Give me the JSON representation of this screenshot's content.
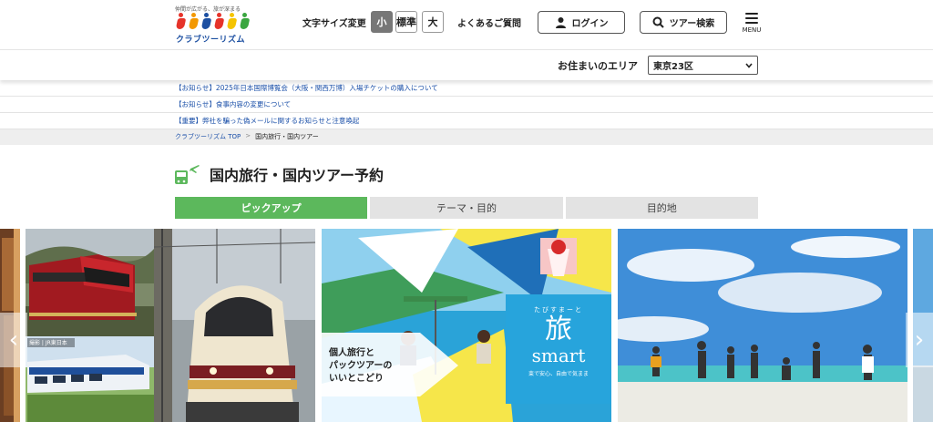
{
  "header": {
    "logo_tagline": "仲間が広がる、旅が深まる",
    "logo_name": "クラブツーリズム",
    "fontsize_label": "文字サイズ変更",
    "fontsize_small": "小",
    "fontsize_standard": "標準",
    "fontsize_large": "大",
    "faq": "よくあるご質問",
    "login": "ログイン",
    "tour_search": "ツアー検索",
    "menu": "MENU"
  },
  "area": {
    "label": "お住まいのエリア",
    "selected": "東京23区"
  },
  "notices": [
    "【お知らせ】2025年日本国際博覧会（大阪・関西万博）入場チケットの購入について",
    "【お知らせ】食事内容の変更について",
    "【重要】弊社を騙った偽メールに関するお知らせと注意喚起"
  ],
  "breadcrumb": {
    "home": "クラブツーリズム TOP",
    "separator": ">",
    "current": "国内旅行・国内ツアー"
  },
  "page_title": "国内旅行・国内ツアー予約",
  "tabs": [
    "ピックアップ",
    "テーマ・目的",
    "目的地"
  ],
  "carousel": {
    "slide2_small_label": "撮影 | JR東日本",
    "slide3_left_text_1": "個人旅行と",
    "slide3_left_text_2": "パックツアーの",
    "slide3_left_text_3": "いいとこどり",
    "slide3_brand_kana": "たびすまーと",
    "slide3_brand_kanji": "旅",
    "slide3_brand_latin": "smart",
    "slide3_brand_sub": "束で安心、自由で気まま",
    "prev_arrow": "‹",
    "next_arrow": "›"
  },
  "colors": {
    "tab_active": "#5cb85c",
    "link_blue": "#1a4fa8",
    "brand_blue": "#1c4fa1"
  }
}
